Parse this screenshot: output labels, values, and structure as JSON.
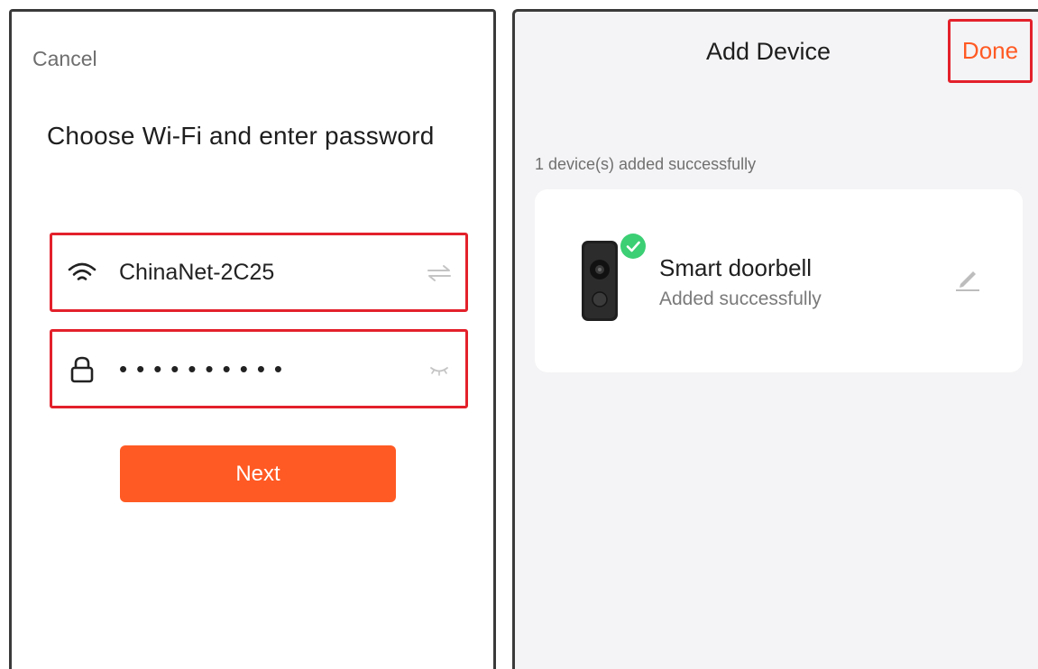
{
  "left": {
    "cancel_label": "Cancel",
    "title": "Choose Wi-Fi and enter password",
    "wifi": {
      "icon": "wifi-icon",
      "ssid": "ChinaNet-2C25",
      "action_icon": "switch-network-icon"
    },
    "password": {
      "icon": "lock-icon",
      "masked_value": "••••••••••",
      "action_icon": "hide-password-icon"
    },
    "next_label": "Next"
  },
  "right": {
    "title": "Add Device",
    "done_label": "Done",
    "status_text": "1 device(s) added successfully",
    "device": {
      "name": "Smart doorbell",
      "status": "Added successfully",
      "image_icon": "doorbell-device-icon",
      "badge_icon": "check-badge-icon",
      "edit_icon": "edit-pencil-icon"
    }
  },
  "colors": {
    "accent": "#ff5a24",
    "highlight": "#e3212b",
    "success": "#3ccf74"
  }
}
